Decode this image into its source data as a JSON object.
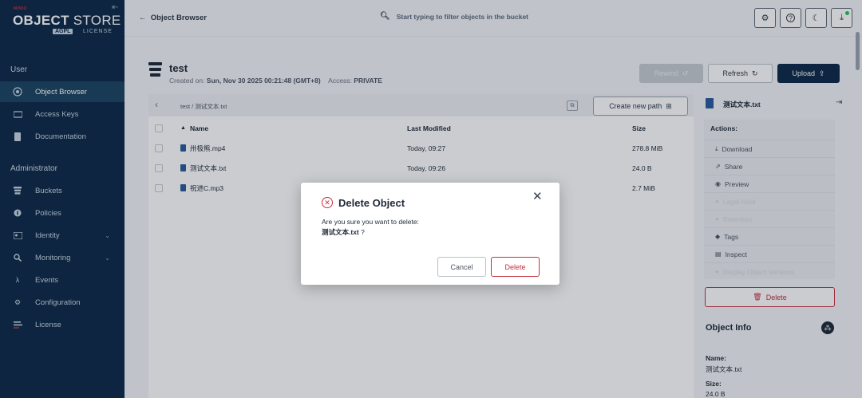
{
  "sidebar": {
    "logo": {
      "brand": "MINIO",
      "product_bold": "OBJECT",
      "product_rest": " STORE",
      "badge": "AGPL",
      "license": "LICENSE"
    },
    "user_section": "User",
    "user_items": [
      {
        "label": "Object Browser",
        "icon": "object-browser-icon",
        "active": true
      },
      {
        "label": "Access Keys",
        "icon": "key-icon"
      },
      {
        "label": "Documentation",
        "icon": "book-icon"
      }
    ],
    "admin_section": "Administrator",
    "admin_items": [
      {
        "label": "Buckets",
        "icon": "bucket-icon"
      },
      {
        "label": "Policies",
        "icon": "policy-icon"
      },
      {
        "label": "Identity",
        "icon": "identity-icon",
        "expandable": true
      },
      {
        "label": "Monitoring",
        "icon": "monitoring-icon",
        "expandable": true
      },
      {
        "label": "Events",
        "icon": "lambda-icon"
      },
      {
        "label": "Configuration",
        "icon": "gear-icon"
      },
      {
        "label": "License",
        "icon": "license-icon"
      }
    ]
  },
  "topbar": {
    "back_label": "Object Browser",
    "search_placeholder": "Start typing to filter objects in the bucket"
  },
  "bucket": {
    "name": "test",
    "created_label": "Created on:",
    "created_value": "Sun, Nov 30 2025 00:21:48 (GMT+8)",
    "access_label": "Access:",
    "access_value": "PRIVATE",
    "rewind_label": "Rewind",
    "refresh_label": "Refresh",
    "upload_label": "Upload"
  },
  "browser": {
    "breadcrumb": "test / 测试文本.txt",
    "create_path_label": "Create new path",
    "columns": {
      "name": "Name",
      "modified": "Last Modified",
      "size": "Size"
    },
    "rows": [
      {
        "name": "卅极熊.mp4",
        "modified": "Today, 09:27",
        "size": "278.8 MiB"
      },
      {
        "name": "测试文本.txt",
        "modified": "Today, 09:26",
        "size": "24.0 B"
      },
      {
        "name": "祝进C.mp3",
        "modified": "",
        "size": "2.7 MiB"
      }
    ]
  },
  "details": {
    "file_name": "测试文本.txt",
    "actions_label": "Actions:",
    "actions": [
      {
        "label": "Download",
        "icon": "download-icon",
        "enabled": true
      },
      {
        "label": "Share",
        "icon": "share-icon",
        "enabled": true
      },
      {
        "label": "Preview",
        "icon": "eye-icon",
        "enabled": true
      },
      {
        "label": "Legal Hold",
        "icon": "legal-hold-icon",
        "enabled": false
      },
      {
        "label": "Retention",
        "icon": "retention-icon",
        "enabled": false
      },
      {
        "label": "Tags",
        "icon": "tag-icon",
        "enabled": true
      },
      {
        "label": "Inspect",
        "icon": "inspect-icon",
        "enabled": true
      },
      {
        "label": "Display Object Versions",
        "icon": "versions-icon",
        "enabled": false
      }
    ],
    "delete_label": "Delete",
    "object_info_title": "Object Info",
    "name_label": "Name:",
    "name_value": "测试文本.txt",
    "size_label": "Size:",
    "size_value": "24.0 B"
  },
  "modal": {
    "title": "Delete Object",
    "message": "Are you sure you want to delete:",
    "file_name": "测试文本.txt",
    "suffix": " ?",
    "cancel_label": "Cancel",
    "delete_label": "Delete"
  },
  "colors": {
    "sidebar_bg": "#0d2a47",
    "danger": "#c6303e",
    "primary": "#0d2a47"
  }
}
